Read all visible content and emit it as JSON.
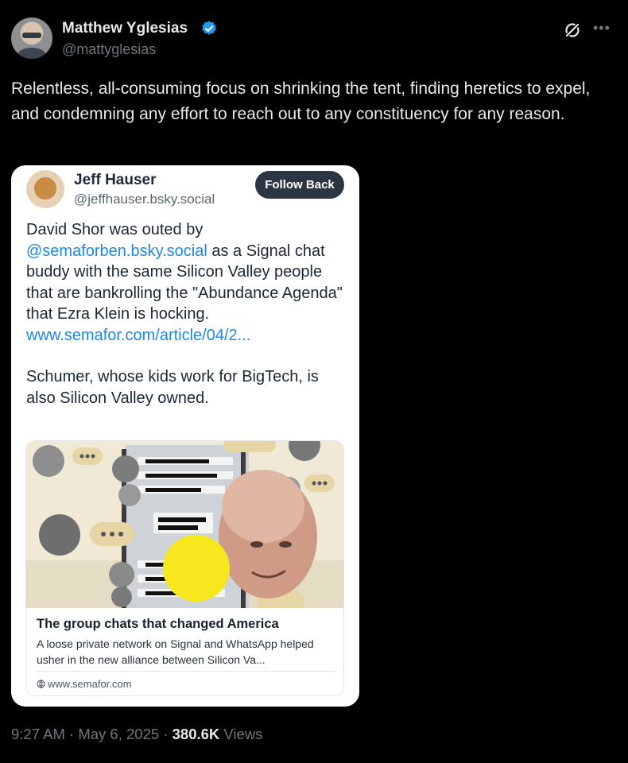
{
  "author": {
    "name": "Matthew Yglesias",
    "handle": "@mattyglesias",
    "verified_color": "#1d9bf0",
    "icons": [
      "verified-badge-icon",
      "grok-icon",
      "more-icon"
    ]
  },
  "tweet": {
    "text": "Relentless, all-consuming focus on shrinking the tent, finding heretics to expel, and condemning any effort to reach out to any constituency for any reason."
  },
  "quote": {
    "name": "Jeff Hauser",
    "handle": "@jeffhauser.bsky.social",
    "follow_label": "Follow Back",
    "text": {
      "part1": "David Shor was outed by ",
      "mention": "@semaforben.bsky.social",
      "part2": " as a Signal chat buddy with the same Silicon Valley people that are bankrolling the \"Abundance Agenda\" that Ezra Klein is hocking. ",
      "url": "www.semafor.com/article/04/2...",
      "para2": "Schumer, whose kids work for BigTech, is also Silicon Valley owned."
    },
    "link_card": {
      "title": "The group chats that changed America",
      "description": "A loose private network on Signal and WhatsApp helped usher in the new alliance between Silicon Va...",
      "domain": "www.semafor.com"
    }
  },
  "footer": {
    "time": "9:27 AM",
    "date": "May 6, 2025",
    "views_count": "380.6K",
    "views_label": "Views",
    "separator": "·"
  },
  "colors": {
    "background": "#000000",
    "text": "#e7e9ea",
    "muted": "#71767b",
    "link": "#1d88e5",
    "follow_button": "#2a3641"
  }
}
